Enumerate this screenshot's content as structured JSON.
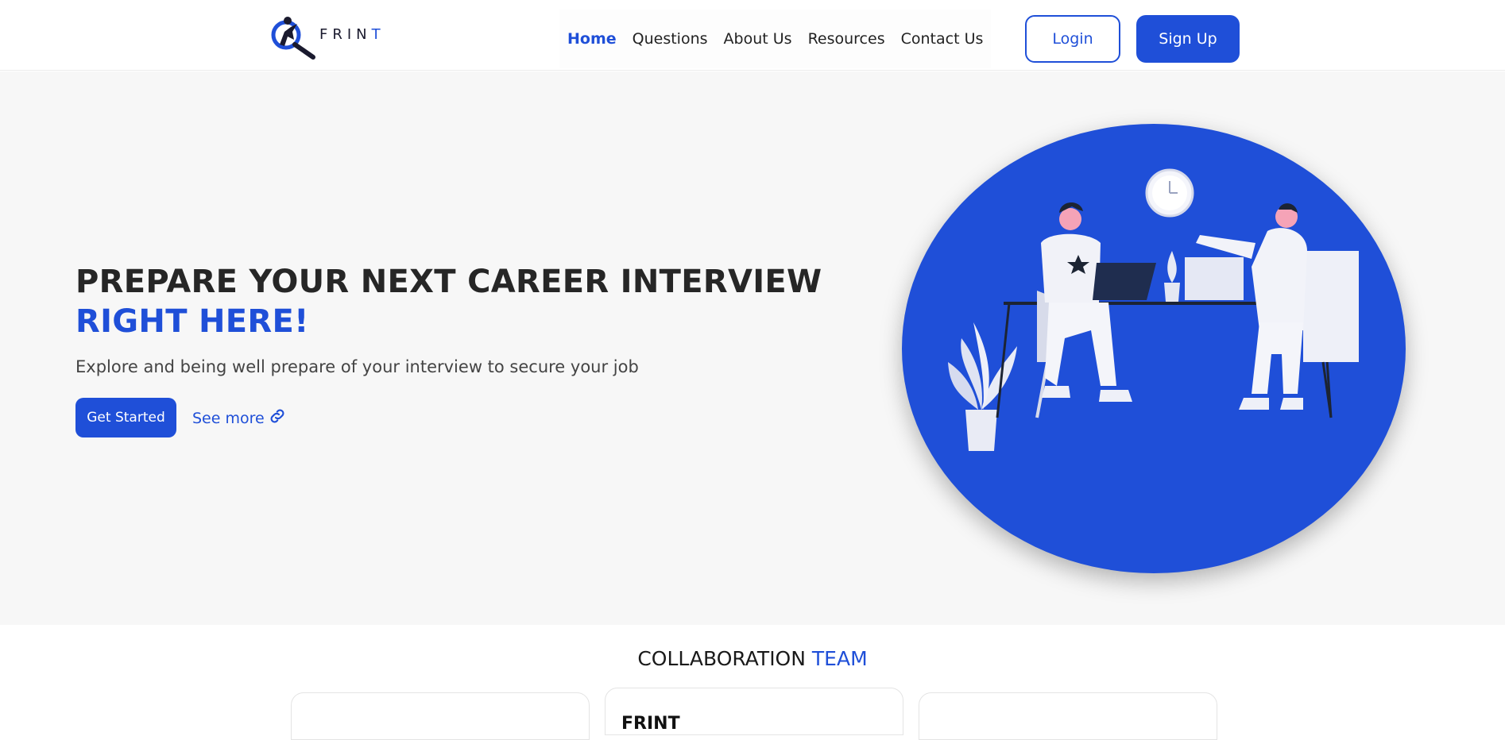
{
  "brand": {
    "name_main": "FRIN",
    "name_accent": "T",
    "logo_icon": "magnifier-person-icon"
  },
  "nav": {
    "items": [
      {
        "label": "Home",
        "active": true
      },
      {
        "label": "Questions",
        "active": false
      },
      {
        "label": "About Us",
        "active": false
      },
      {
        "label": "Resources",
        "active": false
      },
      {
        "label": "Contact Us",
        "active": false
      }
    ]
  },
  "auth": {
    "login_label": "Login",
    "signup_label": "Sign Up"
  },
  "hero": {
    "title_line1": "PREPARE YOUR NEXT CAREER INTERVIEW",
    "title_line2": "RIGHT HERE!",
    "subtitle": "Explore and being well prepare of your interview to secure your job",
    "cta_label": "Get Started",
    "see_more_label": "See more",
    "see_more_icon": "link-icon",
    "illustration": "interview-illustration"
  },
  "team": {
    "title_main": "COLLABORATION",
    "title_accent": "TEAM",
    "cards": [
      {
        "title": ""
      },
      {
        "title": "FRINT"
      },
      {
        "title": ""
      }
    ]
  },
  "colors": {
    "accent": "#1f4fd8",
    "hero_bg": "#f7f7f7",
    "text": "#222222"
  }
}
